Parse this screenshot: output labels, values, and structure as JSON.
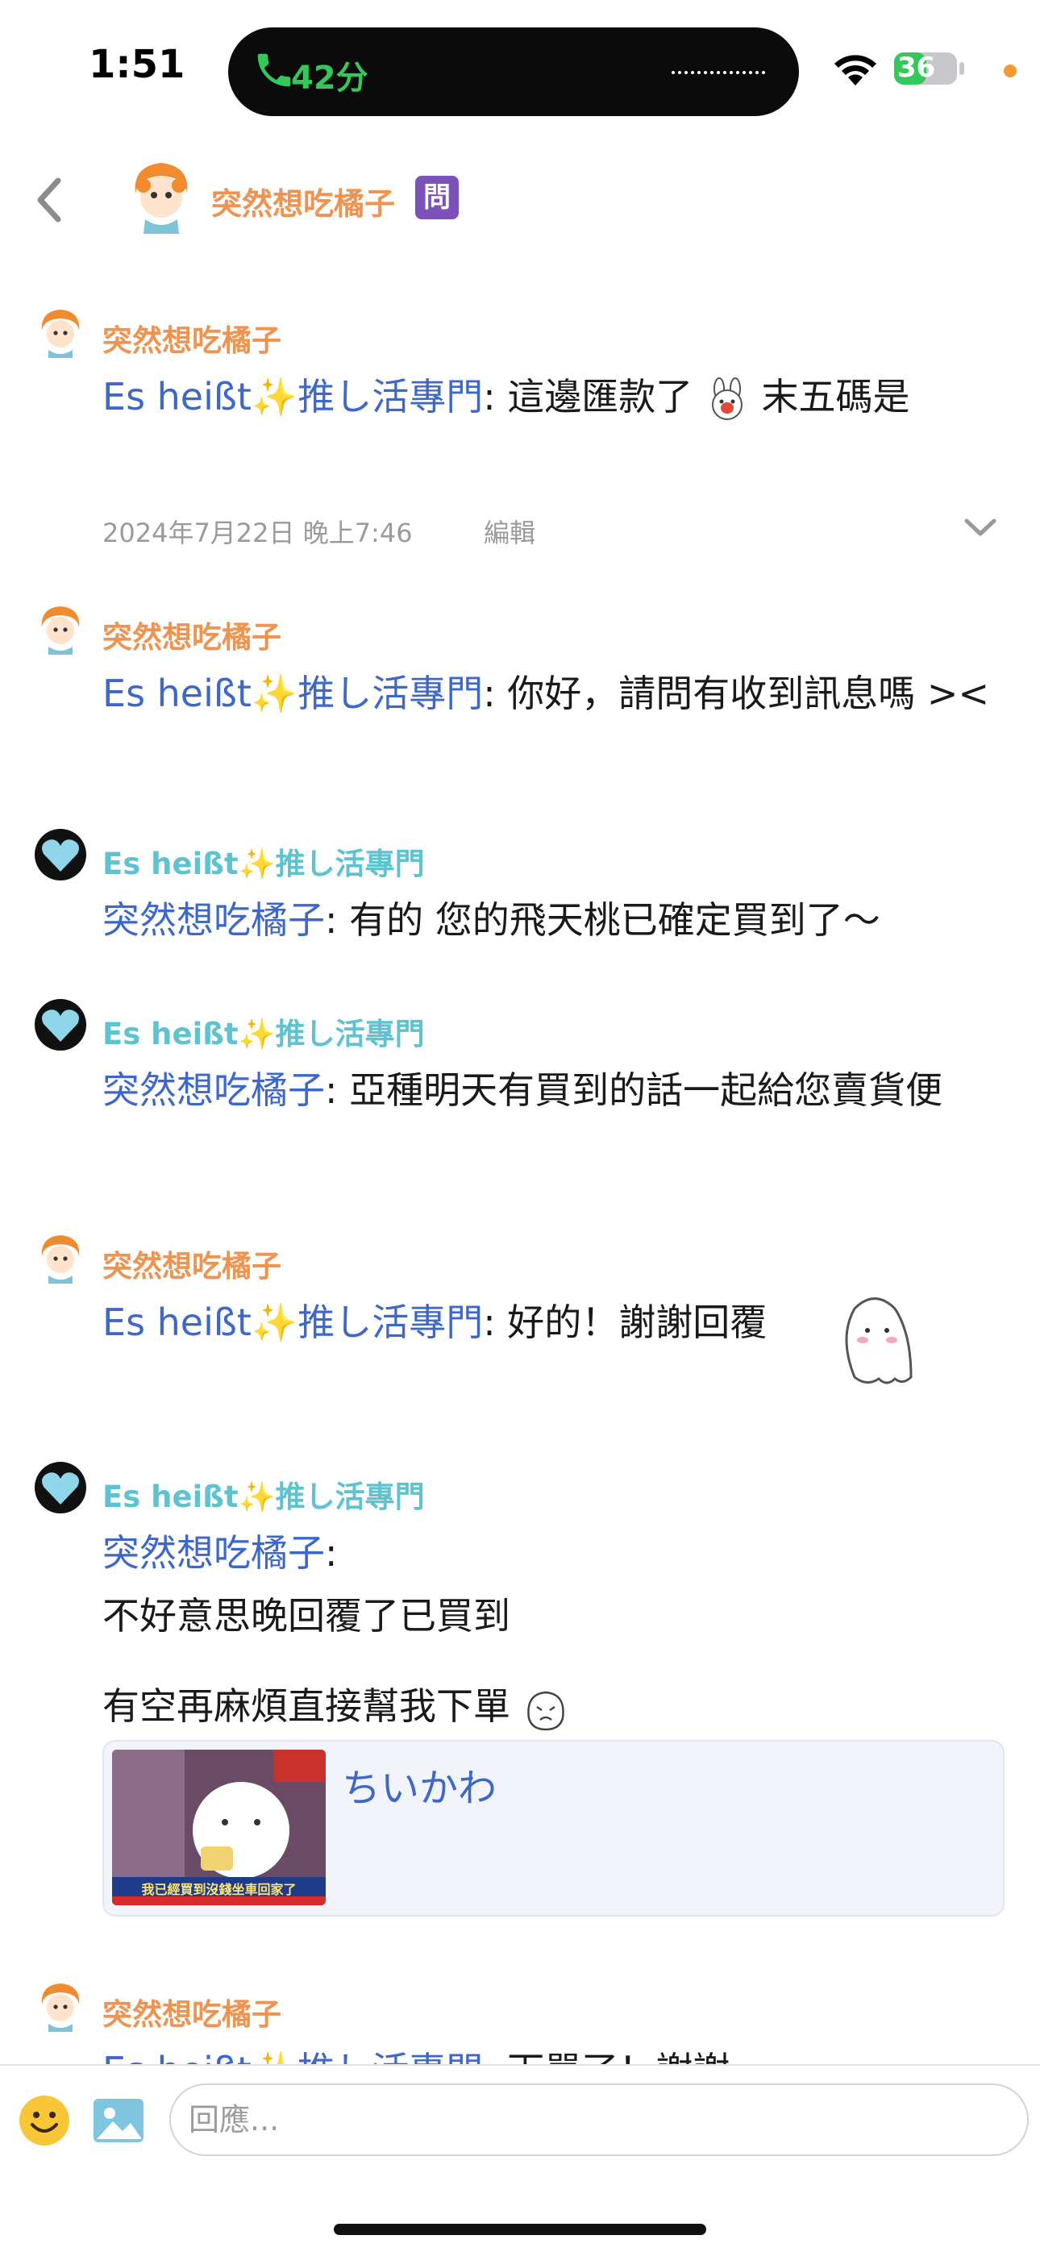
{
  "status_bar": {
    "time": "1:51",
    "call_label": "42分",
    "battery": "36"
  },
  "header": {
    "title": "突然想吃橘子",
    "badge": "問"
  },
  "messages": [
    {
      "sender": "突然想吃橘子",
      "mention": "Es heißt",
      "mention_tail": "推し活專門",
      "text": ": 這邊匯款了",
      "text_after_emoji": " 末五碼是"
    },
    {
      "timestamp": "2024年7月22日 晚上7:46",
      "edit_label": "編輯"
    },
    {
      "sender": "突然想吃橘子",
      "mention": "Es heißt",
      "mention_tail": "推し活專門",
      "text": ": 你好，請問有收到訊息嗎 ><"
    },
    {
      "sender": "Es heißt✨推し活專門",
      "mention": "突然想吃橘子",
      "text": ": 有的 您的飛天桃已確定買到了～"
    },
    {
      "sender": "Es heißt✨推し活專門",
      "mention": "突然想吃橘子",
      "text": ": 亞種明天有買到的話一起給您賣貨便"
    },
    {
      "sender": "突然想吃橘子",
      "mention": "Es heißt",
      "mention_tail": "推し活專門",
      "text": ": 好的！謝謝回覆"
    },
    {
      "sender": "Es heißt✨推し活專門",
      "mention": "突然想吃橘子",
      "text": ":",
      "line2": "不好意思晚回覆了已買到",
      "line3": "有空再麻煩直接幫我下單",
      "card_title": "ちいかわ",
      "thumb_caption": "我已經買到沒錢坐車回家了"
    },
    {
      "sender": "突然想吃橘子",
      "mention": "Es heißt",
      "mention_tail": "推し活專門",
      "text": ": 下單了！謝謝"
    }
  ],
  "input": {
    "placeholder": "回應..."
  }
}
